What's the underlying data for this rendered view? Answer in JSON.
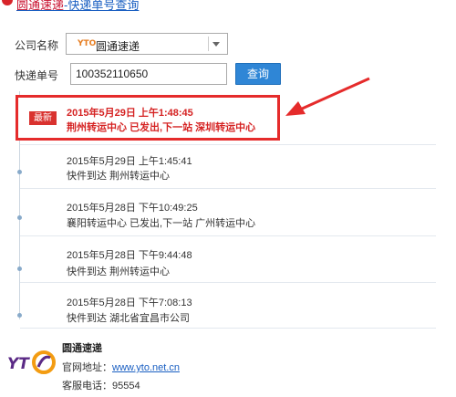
{
  "header": {
    "company": "圆通速递",
    "suffix": "-快递单号查询"
  },
  "form": {
    "company_label": "公司名称",
    "company_value": "圆通速递",
    "company_logo_text": "YTO",
    "tracking_label": "快递单号",
    "tracking_value": "100352110650",
    "query_button": "查询"
  },
  "latest": {
    "badge": "最新",
    "time": "2015年5月29日 上午1:48:45",
    "description": "荆州转运中心 已发出,下一站 深圳转运中心"
  },
  "events": [
    {
      "time": "2015年5月29日 上午1:45:41",
      "description": "快件到达 荆州转运中心"
    },
    {
      "time": "2015年5月28日 下午10:49:25",
      "description": "襄阳转运中心 已发出,下一站 广州转运中心"
    },
    {
      "time": "2015年5月28日 下午9:44:48",
      "description": "快件到达 荆州转运中心"
    },
    {
      "time": "2015年5月28日 下午7:08:13",
      "description": "快件到达 湖北省宜昌市公司"
    }
  ],
  "footer": {
    "company_name": "圆通速递",
    "website_label": "官网地址：",
    "website_url": "www.yto.net.cn",
    "phone_label": "客服电话：",
    "phone": "95554"
  },
  "colors": {
    "accent_blue": "#2f86d6",
    "highlight_red": "#e52b2b",
    "link_blue": "#1a5fc2"
  }
}
